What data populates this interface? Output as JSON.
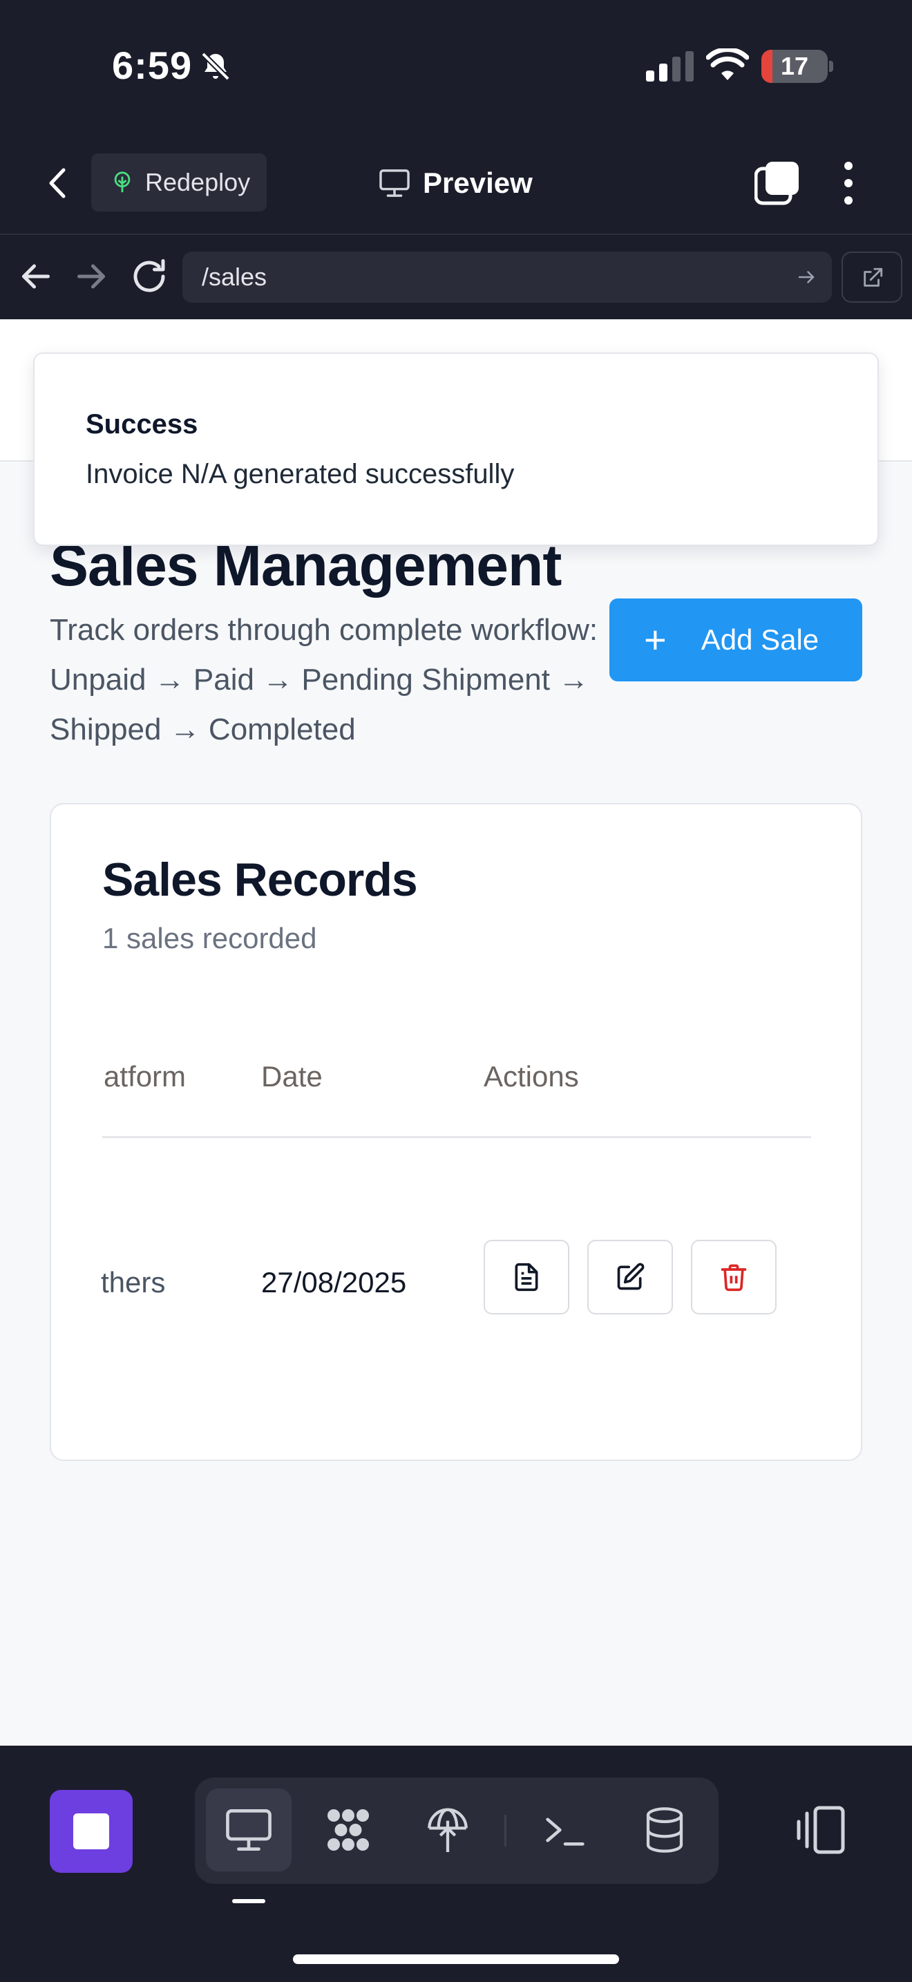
{
  "status_bar": {
    "time": "6:59",
    "battery_level": "17",
    "battery_fill_fraction": 0.17,
    "battery_color": "#e5443c",
    "icons": [
      "bell-off-icon",
      "cellular-signal-icon",
      "wifi-icon",
      "battery-icon"
    ]
  },
  "header": {
    "redeploy_label": "Redeploy",
    "title": "Preview",
    "icons": [
      "chevron-left-icon",
      "tree-icon",
      "monitor-icon",
      "tabs-icon",
      "more-vertical-icon"
    ]
  },
  "browser": {
    "url": "/sales",
    "icons": [
      "arrow-left-icon",
      "arrow-right-icon",
      "refresh-icon",
      "arrow-right-small-icon",
      "external-link-icon"
    ]
  },
  "toast": {
    "title": "Success",
    "message": "Invoice N/A generated successfully"
  },
  "page": {
    "title": "Sales Management",
    "description": "Track orders through complete workflow: Unpaid → Paid → Pending Shipment → Shipped → Completed",
    "add_button_label": "Add Sale",
    "add_button_icon": "plus-icon",
    "accent_color": "#2196f3"
  },
  "records": {
    "title": "Sales Records",
    "subtitle": "1 sales recorded",
    "columns": [
      "atform",
      "Date",
      "Actions"
    ],
    "rows": [
      {
        "platform": "thers",
        "date": "27/08/2025",
        "actions": [
          "file-text-icon",
          "edit-icon",
          "trash-icon"
        ]
      }
    ],
    "delete_color": "#dc2626"
  },
  "bottom_bar": {
    "stop_color": "#6d3ee0",
    "tools": [
      "monitor-icon",
      "grid-dots-icon",
      "deploy-icon",
      "terminal-icon",
      "database-icon"
    ],
    "active_tool": "monitor-icon",
    "panel_icon": "panel-toggle-icon"
  }
}
